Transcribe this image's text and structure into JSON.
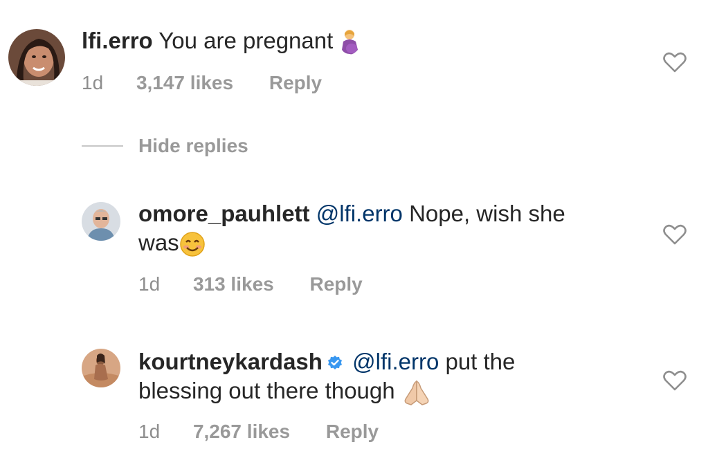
{
  "comments": [
    {
      "username": "lfi.erro",
      "text": "You are pregnant",
      "emoji": "pregnant-woman-emoji",
      "time": "1d",
      "likes": "3,147 likes",
      "reply": "Reply"
    },
    {
      "username": "omore_pauhlett",
      "mention": "@lfi.erro",
      "text": "Nope, wish she",
      "text2": "was",
      "emoji": "smiling-face-emoji",
      "time": "1d",
      "likes": "313 likes",
      "reply": "Reply"
    },
    {
      "username": "kourtneykardash",
      "verified": true,
      "mention": "@lfi.erro",
      "text": "put the",
      "text2": "blessing out there though",
      "emoji": "folded-hands-emoji",
      "time": "1d",
      "likes": "7,267 likes",
      "reply": "Reply"
    }
  ],
  "hide_replies": "Hide replies",
  "colors": {
    "text": "#262626",
    "mention": "#003569",
    "meta": "#8e8e8e",
    "verified": "#3897f0"
  },
  "icons": [
    "heart-outline-icon",
    "verified-badge-icon"
  ]
}
